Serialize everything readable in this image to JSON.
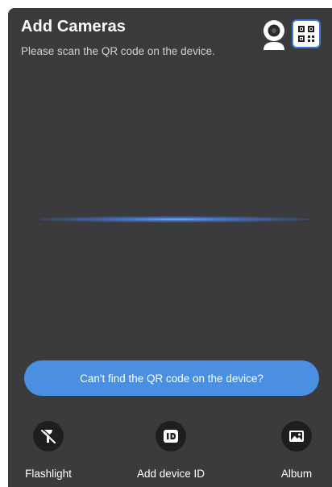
{
  "header": {
    "title": "Add Cameras",
    "subtitle": "Please scan the QR code on the device."
  },
  "mode_icons": {
    "camera": "camera-icon",
    "qr": "qr-code-icon"
  },
  "help_button": {
    "label": "Can't find the QR code on the device?"
  },
  "toolbar": {
    "items": [
      {
        "label": "Flashlight",
        "icon": "flashlight-off-icon"
      },
      {
        "label": "Add device ID",
        "icon": "device-id-icon"
      },
      {
        "label": "Album",
        "icon": "image-icon"
      }
    ]
  },
  "colors": {
    "background": "#3b3b3e",
    "accent": "#4a8fe2",
    "qr_border": "#3a78d8",
    "icon_circle": "#1e1e20"
  }
}
